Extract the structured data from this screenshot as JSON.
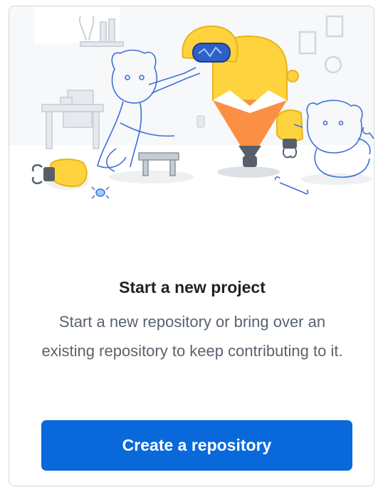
{
  "card": {
    "title": "Start a new project",
    "description": "Start a new repository or bring over an existing repository to keep contributing to it.",
    "create_button_label": "Create a repository"
  },
  "colors": {
    "accent": "#0969da",
    "title_text": "#1f2328",
    "muted_text": "#59636e",
    "border": "#d0d7de",
    "illustration_yellow": "#ffd33d",
    "illustration_orange": "#fb8f44",
    "illustration_blue_line": "#3e6fd8"
  },
  "icons": [
    "octocat-illustration",
    "robot-illustration",
    "pencil-robot-illustration",
    "wrench-icon",
    "bug-icon",
    "desk-illustration",
    "stool-illustration"
  ]
}
